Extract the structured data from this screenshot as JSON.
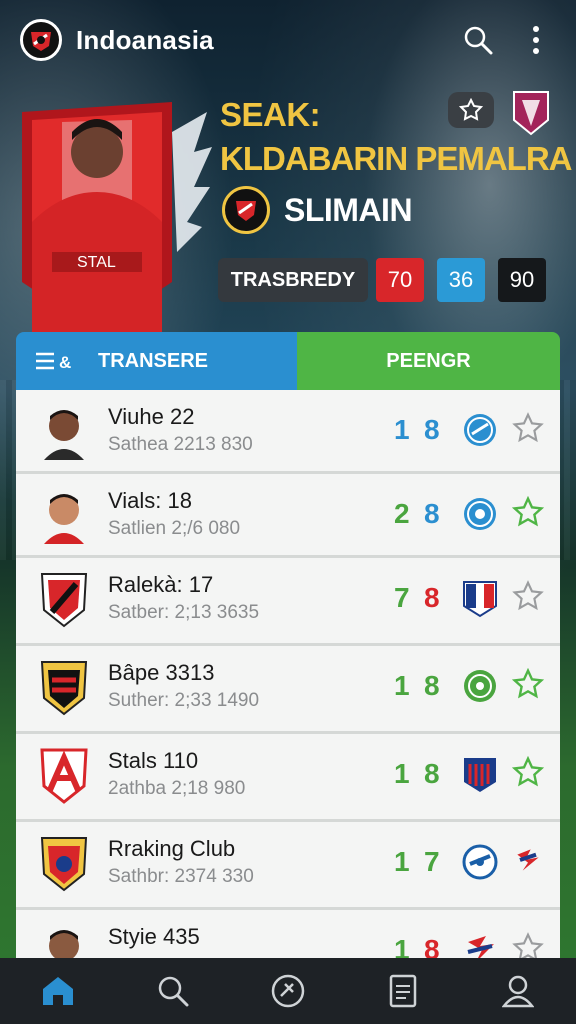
{
  "app": {
    "title": "Indoanasia"
  },
  "hero": {
    "title_line1": "SEAK:",
    "title_line2": "KLDABARIN PEMALRA",
    "club_name": "SLIMAIN",
    "stat_label": "TRASBREDY",
    "stats": [
      {
        "value": "70",
        "color": "#d8262a"
      },
      {
        "value": "36",
        "color": "#2b9ad6"
      },
      {
        "value": "90",
        "color": "#15181b"
      }
    ]
  },
  "tabs": {
    "left_icon_text": "≡&",
    "left_label": "TRANSERE",
    "right_label": "PEENGR"
  },
  "list": [
    {
      "name": "Viuhe 22",
      "sub": "Sathea 2213 830",
      "s1": "1",
      "s2": "8",
      "s1_color": "#2b8fd0",
      "s2_color": "#2b8fd0",
      "avatar": "player-face",
      "club": "blue-round-crest",
      "fav": false
    },
    {
      "name": "Vials: 18",
      "sub": "Satlien 2;/6 080",
      "s1": "2",
      "s2": "8",
      "s1_color": "#4aa53f",
      "s2_color": "#2b8fd0",
      "avatar": "player-face",
      "club": "blue-round-crest",
      "fav": true
    },
    {
      "name": "Ralekà: 17",
      "sub": "Satber: 2;13 3635",
      "s1": "7",
      "s2": "8",
      "s1_color": "#4aa53f",
      "s2_color": "#d8262a",
      "avatar": "red-black-shield",
      "club": "red-blue-shield",
      "fav": false
    },
    {
      "name": "Bâpe 3313",
      "sub": "Suther: 2;33 1490",
      "s1": "1",
      "s2": "8",
      "s1_color": "#4aa53f",
      "s2_color": "#4aa53f",
      "avatar": "red-black-stripe-shield",
      "club": "green-round-crest",
      "fav": true
    },
    {
      "name": "Stals 110",
      "sub": "2athba 2;18 980",
      "s1": "1",
      "s2": "8",
      "s1_color": "#4aa53f",
      "s2_color": "#4aa53f",
      "avatar": "red-white-shield",
      "club": "stripe-shield",
      "fav": true
    },
    {
      "name": "Rraking Club",
      "sub": "Sathbr: 2374 330",
      "s1": "1",
      "s2": "7",
      "s1_color": "#4aa53f",
      "s2_color": "#4aa53f",
      "avatar": "yellow-red-shield",
      "club": "blue-round-crest",
      "fav": false
    },
    {
      "name": "Styie 435",
      "sub": "",
      "s1": "1",
      "s2": "8",
      "s1_color": "#4aa53f",
      "s2_color": "#d8262a",
      "avatar": "player-face",
      "club": "eagle-crest",
      "fav": false
    }
  ],
  "nav": [
    "home-icon",
    "search-icon",
    "ball-icon",
    "document-icon",
    "profile-icon"
  ],
  "colors": {
    "accent_blue": "#2a8fd0",
    "accent_green": "#4fb545",
    "gold": "#f0c542",
    "star_green": "#4fb545"
  }
}
